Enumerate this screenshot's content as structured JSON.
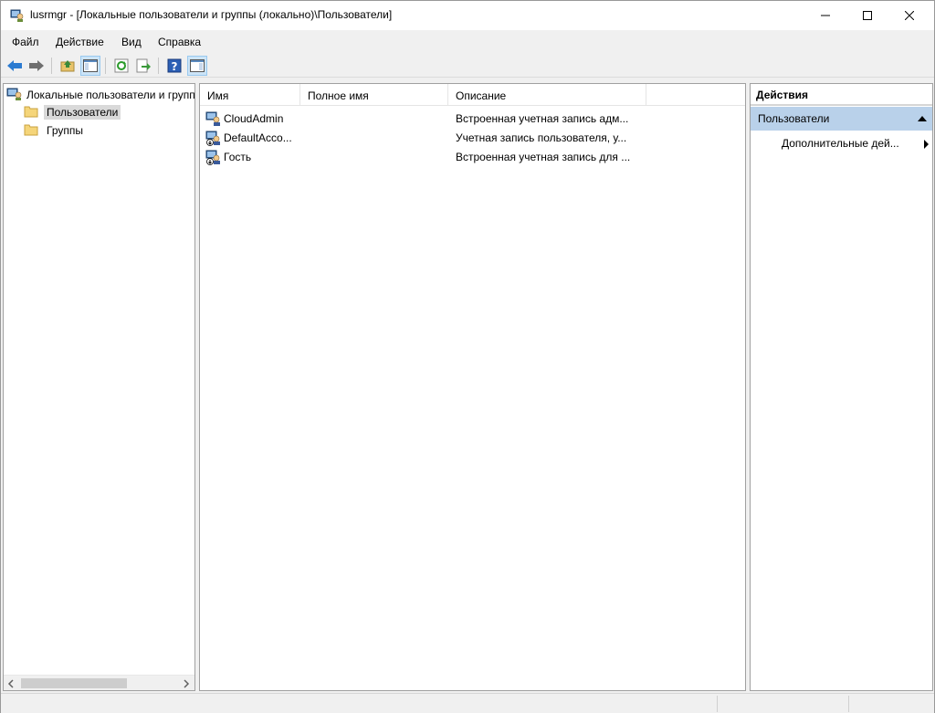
{
  "window": {
    "title": "lusrmgr - [Локальные пользователи и группы (локально)\\Пользователи]"
  },
  "menu": [
    {
      "label": "Файл"
    },
    {
      "label": "Действие"
    },
    {
      "label": "Вид"
    },
    {
      "label": "Справка"
    }
  ],
  "toolbar": {
    "buttons": [
      "back-icon",
      "forward-icon",
      "up-folder-icon",
      "show-hide-tree-icon",
      "refresh-icon",
      "export-list-icon",
      "help-icon",
      "show-hide-action-pane-icon"
    ]
  },
  "tree": {
    "root": "Локальные пользователи и группы (локально)",
    "nodes": [
      {
        "label": "Пользователи",
        "selected": true
      },
      {
        "label": "Группы",
        "selected": false
      }
    ]
  },
  "list": {
    "columns": [
      "Имя",
      "Полное имя",
      "Описание"
    ],
    "rows": [
      {
        "name": "CloudAdmin",
        "full_name": "",
        "description": "Встроенная учетная запись адм...",
        "icon": "user-icon"
      },
      {
        "name": "DefaultAcco...",
        "full_name": "",
        "description": "Учетная запись пользователя, у...",
        "icon": "disabled-user-icon"
      },
      {
        "name": "Гость",
        "full_name": "",
        "description": "Встроенная учетная запись для ...",
        "icon": "disabled-user-icon"
      }
    ]
  },
  "actions": {
    "header": "Действия",
    "section": "Пользователи",
    "items": [
      {
        "label": "Дополнительные дей..."
      }
    ]
  },
  "colors": {
    "section_bg": "#b9d1ea",
    "selected_bg": "#d9d9d9",
    "toolbar_active": "#cce4f7"
  }
}
